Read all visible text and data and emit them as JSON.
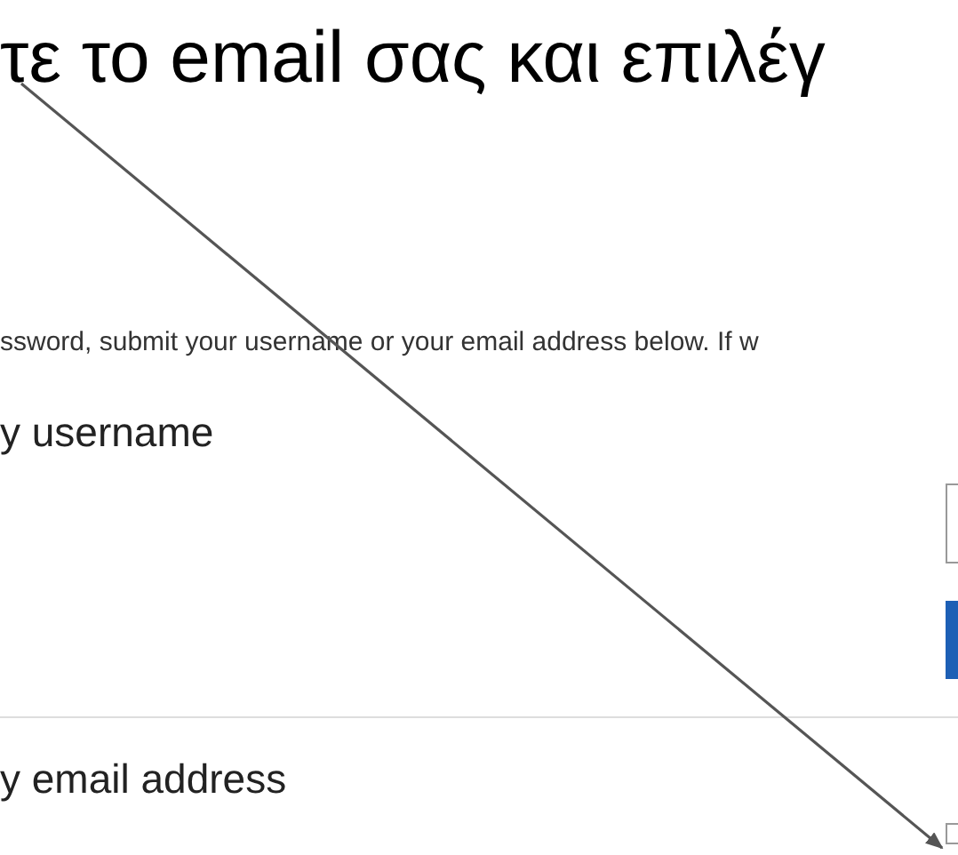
{
  "instruction": "τε το email σας και επιλέγ",
  "page": {
    "intro": "ssword, submit your username or your email address below. If w",
    "sections": [
      {
        "heading": "y username",
        "kind": "field_button"
      },
      {
        "heading": "y email address",
        "kind": "field"
      }
    ]
  }
}
